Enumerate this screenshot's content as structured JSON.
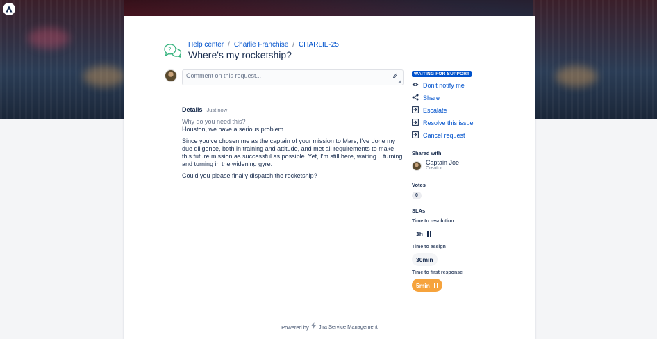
{
  "breadcrumb": {
    "items": [
      "Help center",
      "Charlie Franchise",
      "CHARLIE-25"
    ],
    "separator": "/"
  },
  "request": {
    "title": "Where's my rocketship?"
  },
  "comment": {
    "placeholder": "Comment on this request..."
  },
  "details": {
    "label": "Details",
    "time": "Just now",
    "question": "Why do you need this?",
    "paragraphs": [
      "Houston, we have a serious problem.",
      "Since you've chosen me as the captain of your mission to Mars, I've done my due diligence, both in training and attitude, and met all requirements to make this future mission as successful as possible. Yet, I'm still here, waiting... turning and turning in the widening gyre.",
      "Could you please finally dispatch the rocketship?"
    ]
  },
  "sidebar": {
    "status": "WAITING FOR SUPPORT",
    "actions": [
      {
        "label": "Don't notify me",
        "icon": "eye-icon"
      },
      {
        "label": "Share",
        "icon": "share-icon"
      },
      {
        "label": "Escalate",
        "icon": "escalate-icon"
      },
      {
        "label": "Resolve this issue",
        "icon": "resolve-icon"
      },
      {
        "label": "Cancel request",
        "icon": "cancel-icon"
      }
    ],
    "shared_with": {
      "title": "Shared with",
      "name": "Captain Joe",
      "role": "Creator"
    },
    "votes": {
      "title": "Votes",
      "count": "0"
    },
    "slas": {
      "title": "SLAs",
      "items": [
        {
          "label": "Time to resolution",
          "value": "3h",
          "paused": true
        },
        {
          "label": "Time to assign",
          "value": "30min",
          "paused": false
        },
        {
          "label": "Time to first response",
          "value": "5min",
          "paused": true
        }
      ]
    }
  },
  "footer": {
    "powered_by": "Powered by",
    "product": "Jira Service Management"
  },
  "colors": {
    "link": "#0052cc",
    "status": "#0052cc",
    "sla_warning": "#f6a33c"
  }
}
